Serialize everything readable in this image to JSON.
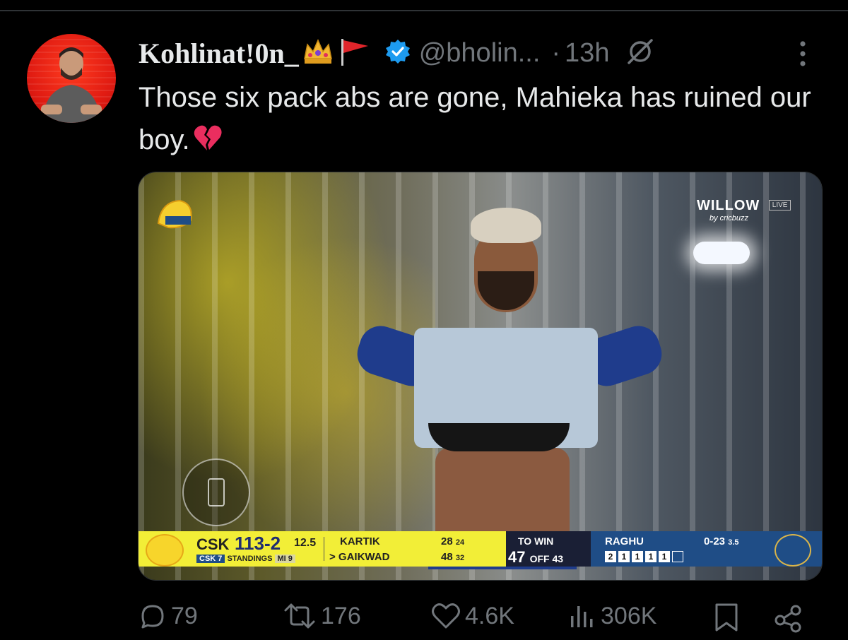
{
  "tweet": {
    "display_name": "Kohlinat!0n_",
    "name_emojis": [
      "crown-emoji",
      "red-flag-emoji"
    ],
    "handle": "@bholin...",
    "time_separator": "·",
    "time": "13h",
    "text": "Those six pack abs are gone, Mahieka has ruined our boy.",
    "text_emoji": "broken-heart-emoji"
  },
  "media": {
    "broadcaster": "WILLOW",
    "live_tag": "LIVE",
    "broadcaster_sub": "by cricbuzz",
    "scorebar": {
      "team": "CSK",
      "score": "113-2",
      "overs": "12.5",
      "standings_left": "CSK 7",
      "standings_label": "STANDINGS",
      "standings_right": "MI 9",
      "batter1": "KARTIK",
      "batter1_runs": "28",
      "batter1_balls": "24",
      "batter2": "> GAIKWAD",
      "batter2_runs": "48",
      "batter2_balls": "32",
      "to_win_label": "TO WIN",
      "runs_needed": "47",
      "off_balls": "OFF 43",
      "bowler": "RAGHU",
      "bowler_figures": "0-23",
      "bowler_overs": "3.5",
      "over_balls": [
        "2",
        "1",
        "1",
        "1",
        "1",
        ""
      ]
    }
  },
  "actions": {
    "replies": "79",
    "reposts": "176",
    "likes": "4.6K",
    "views": "306K"
  },
  "colors": {
    "background": "#000000",
    "text": "#e7e9ea",
    "muted": "#71767b",
    "verified": "#1d9bf0"
  }
}
